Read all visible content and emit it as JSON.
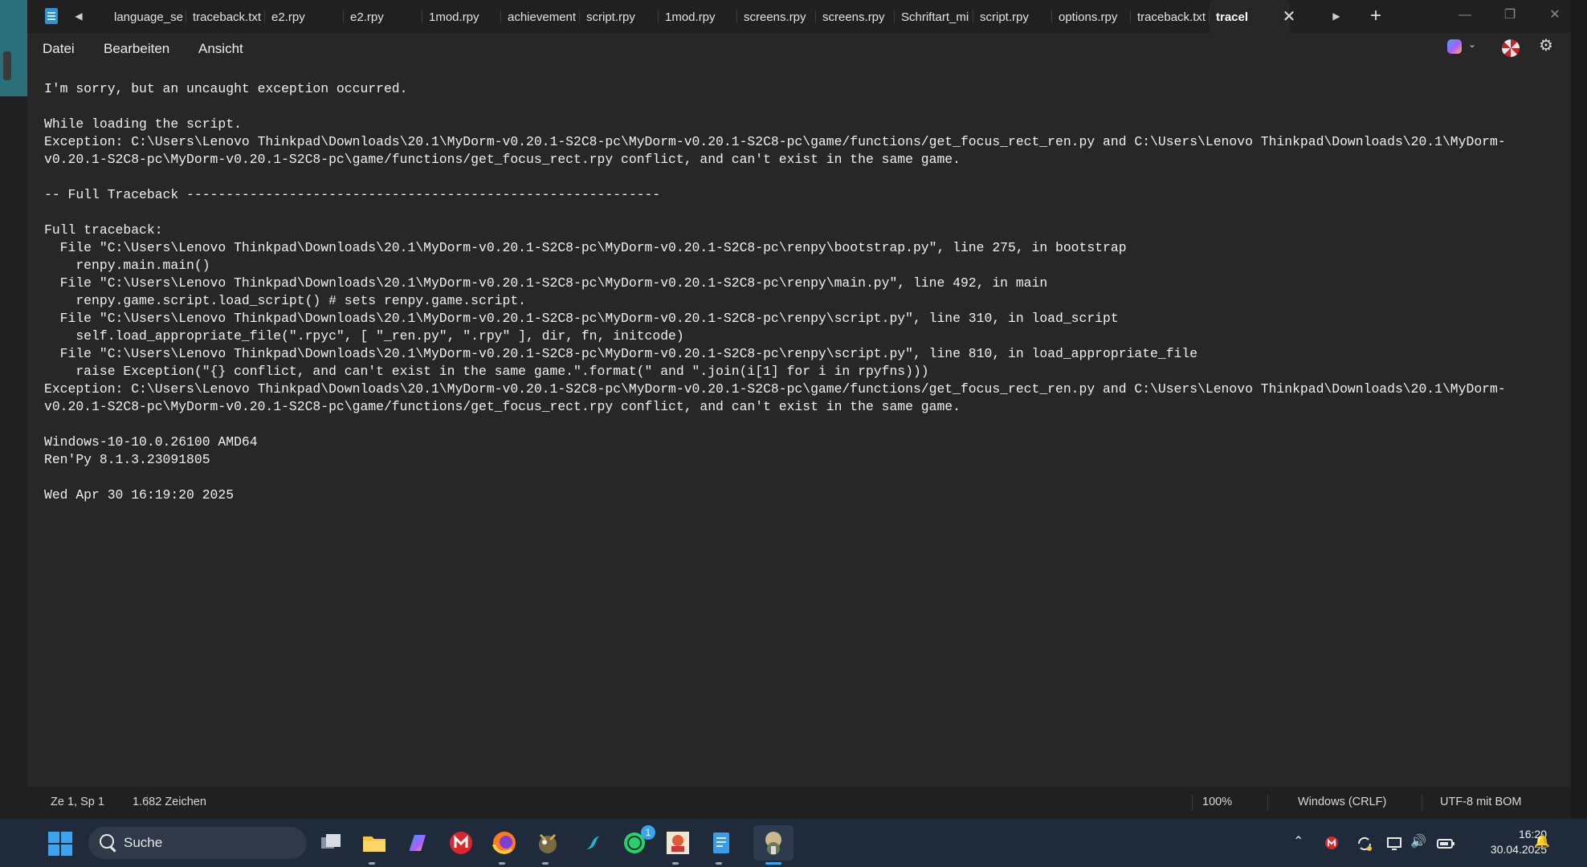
{
  "desktop_left_fragment": {
    "line1": "0",
    "line2": "5"
  },
  "window": {
    "tabs": [
      {
        "label": "language_se"
      },
      {
        "label": "traceback.txt"
      },
      {
        "label": "e2.rpy"
      },
      {
        "label": "e2.rpy"
      },
      {
        "label": "1mod.rpy"
      },
      {
        "label": "achievement"
      },
      {
        "label": "script.rpy"
      },
      {
        "label": "1mod.rpy"
      },
      {
        "label": "screens.rpy"
      },
      {
        "label": "screens.rpy"
      },
      {
        "label": "Schriftart_mi"
      },
      {
        "label": "script.rpy"
      },
      {
        "label": "options.rpy"
      },
      {
        "label": "traceback.txt"
      },
      {
        "label": "tracel",
        "active": true
      }
    ],
    "icons": {
      "app": "notepad-icon",
      "tab_scroll_left": "caret-left-icon",
      "tab_scroll_right": "caret-right-icon",
      "close_tab": "close-icon",
      "new_tab": "plus-icon",
      "minimize": "minimize-icon",
      "maximize": "restore-icon",
      "close_window": "close-icon"
    },
    "glyphs": {
      "tab_left": "◀",
      "tab_right": "▶",
      "close": "✕",
      "plus": "+",
      "min": "—",
      "max": "❐",
      "win_close": "✕",
      "chevron": "⌄",
      "gear": "⚙"
    }
  },
  "menu": {
    "items": [
      "Datei",
      "Bearbeiten",
      "Ansicht"
    ],
    "right_icons": [
      "copilot-icon",
      "chevron-down-icon",
      "profile-icon",
      "gear-icon"
    ]
  },
  "document": {
    "lines": [
      "I'm sorry, but an uncaught exception occurred.",
      "",
      "While loading the script.",
      "Exception: C:\\Users\\Lenovo Thinkpad\\Downloads\\20.1\\MyDorm-v0.20.1-S2C8-pc\\MyDorm-v0.20.1-S2C8-pc\\game/functions/get_focus_rect_ren.py and C:\\Users\\Lenovo Thinkpad\\Downloads\\20.1\\MyDorm-",
      "v0.20.1-S2C8-pc\\MyDorm-v0.20.1-S2C8-pc\\game/functions/get_focus_rect.rpy conflict, and can't exist in the same game.",
      "",
      "-- Full Traceback ------------------------------------------------------------",
      "",
      "Full traceback:",
      "  File \"C:\\Users\\Lenovo Thinkpad\\Downloads\\20.1\\MyDorm-v0.20.1-S2C8-pc\\MyDorm-v0.20.1-S2C8-pc\\renpy\\bootstrap.py\", line 275, in bootstrap",
      "    renpy.main.main()",
      "  File \"C:\\Users\\Lenovo Thinkpad\\Downloads\\20.1\\MyDorm-v0.20.1-S2C8-pc\\MyDorm-v0.20.1-S2C8-pc\\renpy\\main.py\", line 492, in main",
      "    renpy.game.script.load_script() # sets renpy.game.script.",
      "  File \"C:\\Users\\Lenovo Thinkpad\\Downloads\\20.1\\MyDorm-v0.20.1-S2C8-pc\\MyDorm-v0.20.1-S2C8-pc\\renpy\\script.py\", line 310, in load_script",
      "    self.load_appropriate_file(\".rpyc\", [ \"_ren.py\", \".rpy\" ], dir, fn, initcode)",
      "  File \"C:\\Users\\Lenovo Thinkpad\\Downloads\\20.1\\MyDorm-v0.20.1-S2C8-pc\\MyDorm-v0.20.1-S2C8-pc\\renpy\\script.py\", line 810, in load_appropriate_file",
      "    raise Exception(\"{} conflict, and can't exist in the same game.\".format(\" and \".join(i[1] for i in rpyfns)))",
      "Exception: C:\\Users\\Lenovo Thinkpad\\Downloads\\20.1\\MyDorm-v0.20.1-S2C8-pc\\MyDorm-v0.20.1-S2C8-pc\\game/functions/get_focus_rect_ren.py and C:\\Users\\Lenovo Thinkpad\\Downloads\\20.1\\MyDorm-",
      "v0.20.1-S2C8-pc\\MyDorm-v0.20.1-S2C8-pc\\game/functions/get_focus_rect.rpy conflict, and can't exist in the same game.",
      "",
      "Windows-10-10.0.26100 AMD64",
      "Ren'Py 8.1.3.23091805",
      "",
      "Wed Apr 30 16:19:20 2025"
    ]
  },
  "status": {
    "position": "Ze 1, Sp 1",
    "characters": "1.682 Zeichen",
    "zoom": "100%",
    "line_endings": "Windows (CRLF)",
    "encoding": "UTF-8 mit BOM"
  },
  "taskbar": {
    "search_label": "Suche",
    "apps": [
      "start-icon",
      "task-view-icon",
      "file-explorer-icon",
      "copilot-icon",
      "mega-icon",
      "firefox-icon",
      "gimp-icon",
      "surfshark-icon",
      "whatsapp-icon",
      "game-icon",
      "notepad-icon",
      "renpy-icon"
    ],
    "whatsapp_badge": "1",
    "tray_icons": [
      "chevron-up-icon",
      "mega-icon",
      "sync-icon",
      "display-icon",
      "volume-icon",
      "battery-icon",
      "notification-icon"
    ],
    "glyphs": {
      "chevron_up": "⌃",
      "volume": "🔊",
      "notification": "🔔"
    },
    "clock": {
      "time": "16:20",
      "date": "30.04.2025"
    }
  },
  "colors": {
    "window_bg": "#272727",
    "titlebar_bg": "#202020",
    "taskbar_bg": "#1f2a3b",
    "accent": "#3ba4f0",
    "spellcheck": "#e24c4c"
  }
}
